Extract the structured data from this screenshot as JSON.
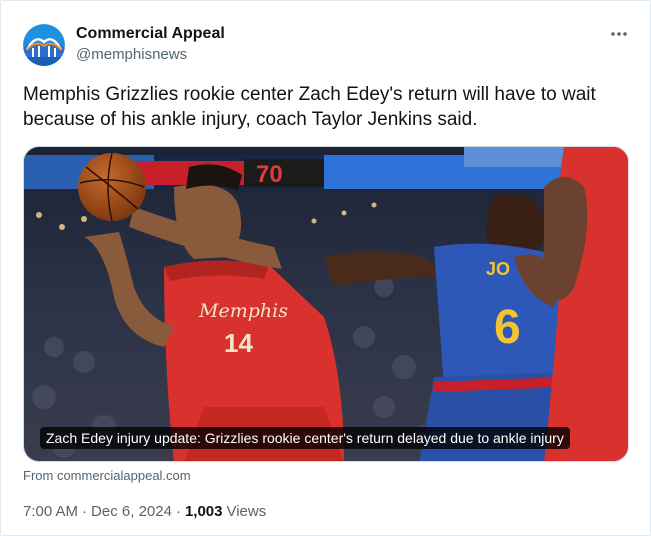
{
  "author": {
    "name": "Commercial Appeal",
    "handle": "@memphisnews",
    "avatar_icon": "commercial-appeal-logo-icon"
  },
  "tweet": {
    "text": "Memphis Grizzlies rookie center Zach Edey's return will have to wait because of his ankle injury, coach Taylor Jenkins said."
  },
  "media": {
    "caption": "Zach Edey injury update: Grizzlies rookie center's return delayed due to ankle injury",
    "scoreboard_value": "70",
    "jersey_left_number": "14",
    "jersey_right_number": "6",
    "jersey_right_name": "JO"
  },
  "link_source": "From commercialappeal.com",
  "meta": {
    "time": "7:00 AM",
    "separator": "·",
    "date": "Dec 6, 2024",
    "views_count": "1,003",
    "views_label": "Views"
  },
  "more_icon": "more-horizontal-icon",
  "colors": {
    "text_primary": "#0f1419",
    "text_secondary": "#536471",
    "border": "#e1e8ed",
    "grizzlies_red": "#d9312e",
    "nuggets_blue": "#2e58b8"
  }
}
